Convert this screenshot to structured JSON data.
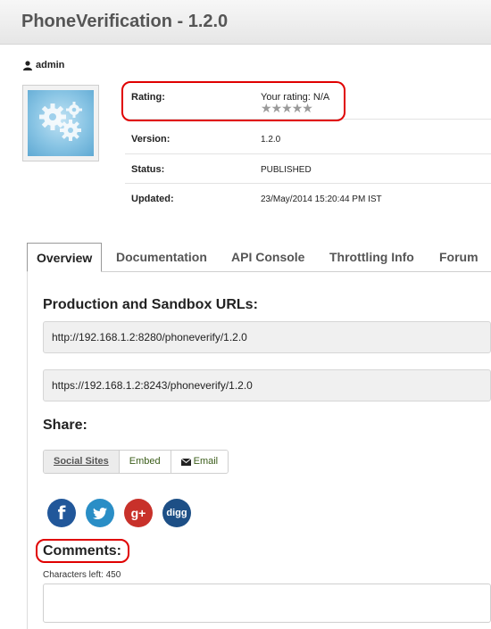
{
  "window": {
    "title": "PhoneVerification - 1.2.0"
  },
  "author": {
    "name": "admin",
    "icon": "user-icon"
  },
  "thumbnail": {
    "icon": "gears-icon"
  },
  "info": {
    "rating_label": "Rating:",
    "your_rating": "Your rating:  N/A",
    "star_count": 5,
    "stars_filled": 0,
    "version_label": "Version:",
    "version": "1.2.0",
    "status_label": "Status:",
    "status": "PUBLISHED",
    "updated_label": "Updated:",
    "updated": "23/May/2014 15:20:44 PM IST"
  },
  "tabs": [
    {
      "label": "Overview",
      "active": true
    },
    {
      "label": "Documentation",
      "active": false
    },
    {
      "label": "API Console",
      "active": false
    },
    {
      "label": "Throttling Info",
      "active": false
    },
    {
      "label": "Forum",
      "active": false
    }
  ],
  "overview": {
    "urls_heading": "Production and Sandbox URLs:",
    "production_url": "http://192.168.1.2:8280/phoneverify/1.2.0",
    "sandbox_url": "https://192.168.1.2:8243/phoneverify/1.2.0",
    "share_heading": "Share:",
    "share_tabs": {
      "social": "Social Sites",
      "embed": "Embed",
      "email": "Email"
    },
    "social_icons": [
      "facebook-icon",
      "twitter-icon",
      "google-plus-icon",
      "digg-icon"
    ],
    "social_glyphs": {
      "facebook": "f",
      "google_plus": "g+",
      "digg": "digg"
    },
    "comments_heading": "Comments:",
    "chars_left": "Characters left: 450"
  },
  "colors": {
    "highlight": "#e00000",
    "facebook": "#21579a",
    "twitter": "#2a8ec6",
    "google_plus": "#c8312a",
    "digg": "#1d4f86"
  }
}
